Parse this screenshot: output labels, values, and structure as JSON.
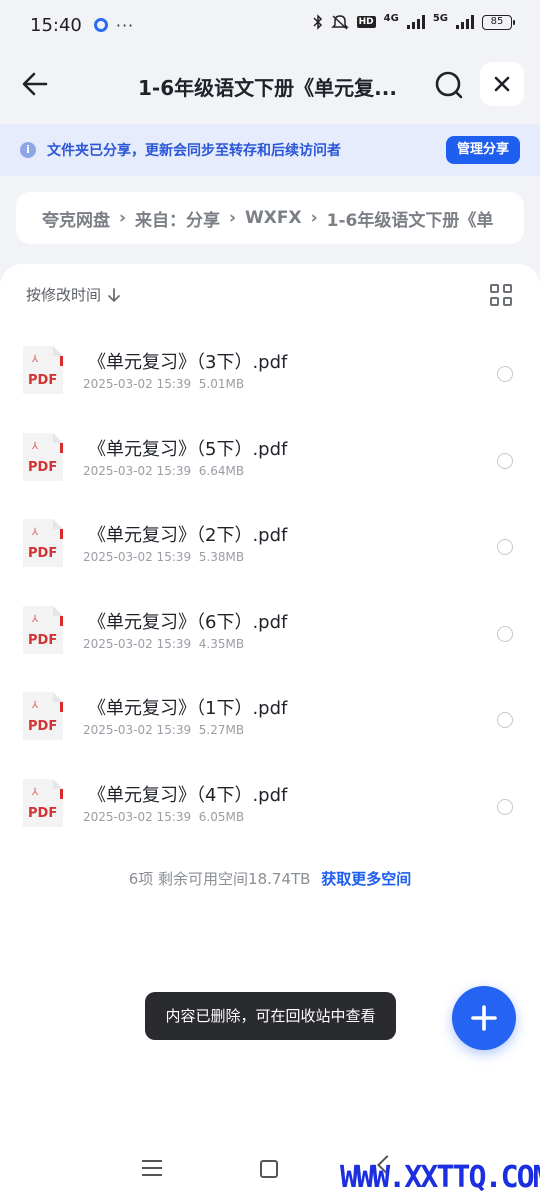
{
  "status_bar": {
    "time": "15:40",
    "more": "···",
    "net1": "4G",
    "net2": "5G",
    "hd": "HD",
    "battery": "85"
  },
  "nav": {
    "title": "1-6年级语文下册《单元复...",
    "back_icon": "arrow-left-icon",
    "search_icon": "search-icon",
    "close_icon": "close-icon"
  },
  "banner": {
    "icon": "i",
    "text": "文件夹已分享，更新会同步至转存和后续访问者",
    "button": "管理分享"
  },
  "breadcrumb": {
    "items": [
      "夸克网盘",
      "来自：分享",
      "WXFX",
      "1-6年级语文下册《单"
    ],
    "separator": "›"
  },
  "list": {
    "sort_label": "按修改时间",
    "sort_arrow": "↓",
    "files": [
      {
        "name": "《单元复习》（3下）.pdf",
        "date": "2025-03-02 15:39",
        "size": "5.01MB"
      },
      {
        "name": "《单元复习》（5下）.pdf",
        "date": "2025-03-02 15:39",
        "size": "6.64MB"
      },
      {
        "name": "《单元复习》（2下）.pdf",
        "date": "2025-03-02 15:39",
        "size": "5.38MB"
      },
      {
        "name": "《单元复习》（6下）.pdf",
        "date": "2025-03-02 15:39",
        "size": "4.35MB"
      },
      {
        "name": "《单元复习》（1下）.pdf",
        "date": "2025-03-02 15:39",
        "size": "5.27MB"
      },
      {
        "name": "《单元复习》（4下）.pdf",
        "date": "2025-03-02 15:39",
        "size": "6.05MB"
      }
    ],
    "file_icon_label": "PDF",
    "summary": "6项  剩余可用空间18.74TB",
    "summary_link": "获取更多空间"
  },
  "toast": "内容已删除，可在回收站中查看",
  "fab_icon": "plus-icon",
  "watermark": "WWW.XXTTQ.COM",
  "colors": {
    "accent": "#1f5ff0",
    "pdf_red": "#d13434",
    "banner_bg": "#e6ecfb"
  }
}
